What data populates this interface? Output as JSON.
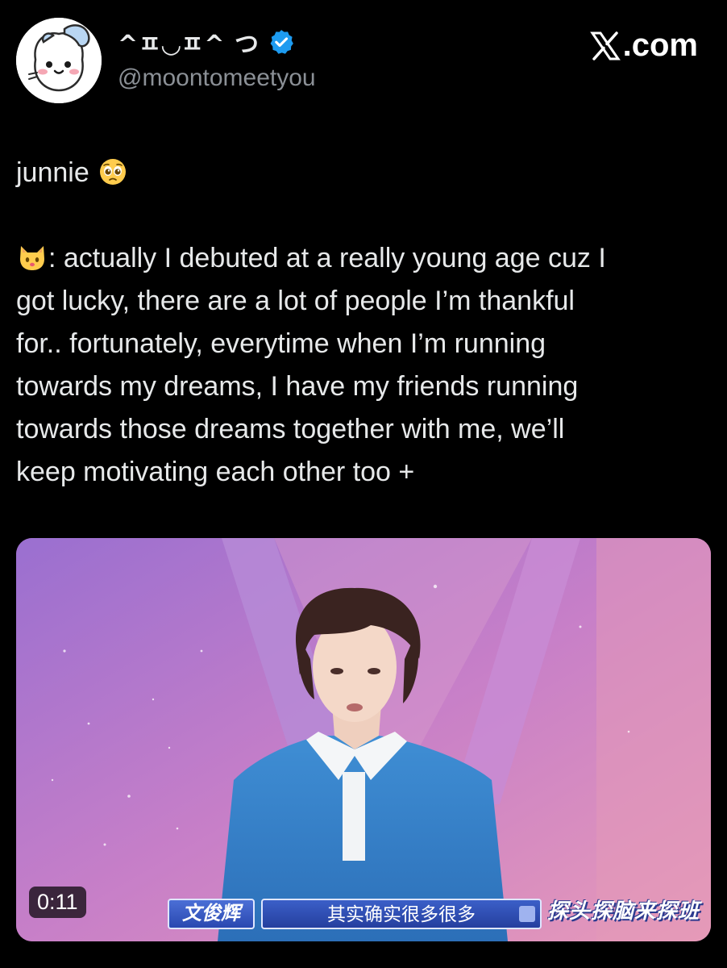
{
  "header": {
    "display_name": "^ㅍ◡ㅍ^ つ",
    "handle": "@moontomeetyou",
    "verified": true,
    "avatar": "cartoon-cat-avatar",
    "brand_label": ".com",
    "brand_icon": "x-logo-icon"
  },
  "tweet": {
    "line1": "junnie",
    "line1_emoji": "pleading-face-emoji",
    "quote_emoji": "cat-face-emoji",
    "quote_lines": [
      ": actually I debuted at a really young age cuz I",
      "got lucky, there are a lot of people I’m thankful",
      "for.. fortunately, everytime when I’m running",
      "towards my dreams, I have my friends running",
      "towards those dreams together with me, we’ll",
      "keep motivating each other too +"
    ]
  },
  "media": {
    "duration": "0:11",
    "name_tag": "文俊辉",
    "subtitle": "其实确实很多很多",
    "show_logo": "探头探脑来探班"
  },
  "colors": {
    "background": "#000000",
    "text": "#e7e9ea",
    "secondary_text": "#8b9096",
    "verified_blue": "#1d9bf0"
  }
}
